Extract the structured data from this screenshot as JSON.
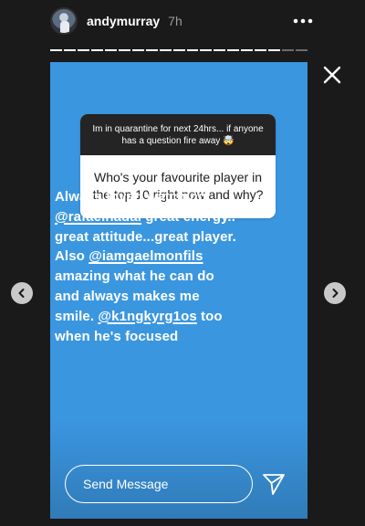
{
  "header": {
    "username": "andymurray",
    "time": "7h"
  },
  "progress": {
    "segments_total": 19,
    "current_segment": 17
  },
  "question": {
    "prompt": "Im in quarantine for next 24hrs... if anyone has a question fire away 🤯",
    "text": "Who's your favourite player in the top 10 right now and why?"
  },
  "answer": {
    "part1": "Always loved watching ",
    "mention1": "@rafaelnadal",
    "part2": " great energy.. great attitude...great player. Also ",
    "mention2": "@iamgaelmonfils",
    "part3": " amazing what he can do and always makes me smile. ",
    "mention3": "@k1ngkyrg1os",
    "part4": " too when he's focused"
  },
  "reply": {
    "placeholder": "Send Message"
  },
  "icons": {
    "more": "more-horizontal-icon",
    "close": "close-icon",
    "send": "send-icon",
    "prev": "chevron-left-icon",
    "next": "chevron-right-icon"
  },
  "colors": {
    "story_background": "#3b96e0",
    "page_background": "#1a1a1a"
  }
}
